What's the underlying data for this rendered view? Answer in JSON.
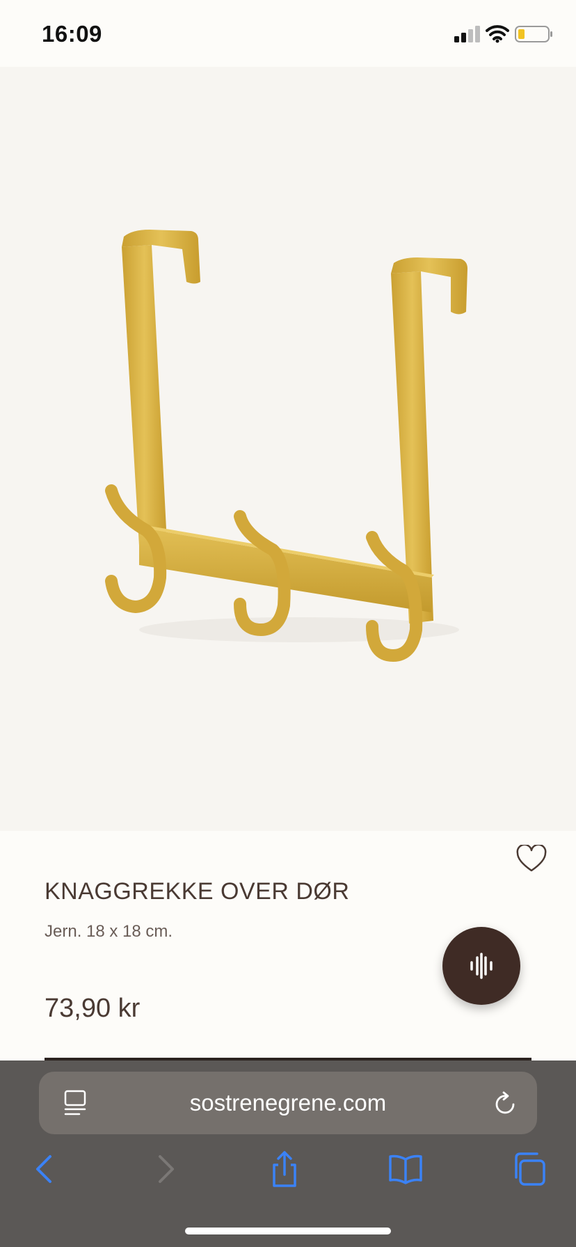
{
  "status_bar": {
    "time": "16:09"
  },
  "product": {
    "title": "KNAGGREKKE OVER DØR",
    "description": "Jern. 18 x 18 cm.",
    "price": "73,90 kr"
  },
  "browser": {
    "url": "sostrenegrene.com"
  },
  "icons": {
    "status": [
      "cellular-signal-icon",
      "wifi-icon",
      "battery-icon"
    ],
    "page": [
      "heart-icon",
      "voice-waveform-icon"
    ],
    "url_bar": [
      "reader-icon",
      "reload-icon"
    ],
    "toolbar": [
      "back-icon",
      "forward-icon",
      "share-icon",
      "bookmarks-icon",
      "tabs-icon"
    ]
  },
  "colors": {
    "accent_blue": "#3b82f6",
    "brand_dark": "#3f2b25",
    "product_gold": "#d6ad3a"
  }
}
